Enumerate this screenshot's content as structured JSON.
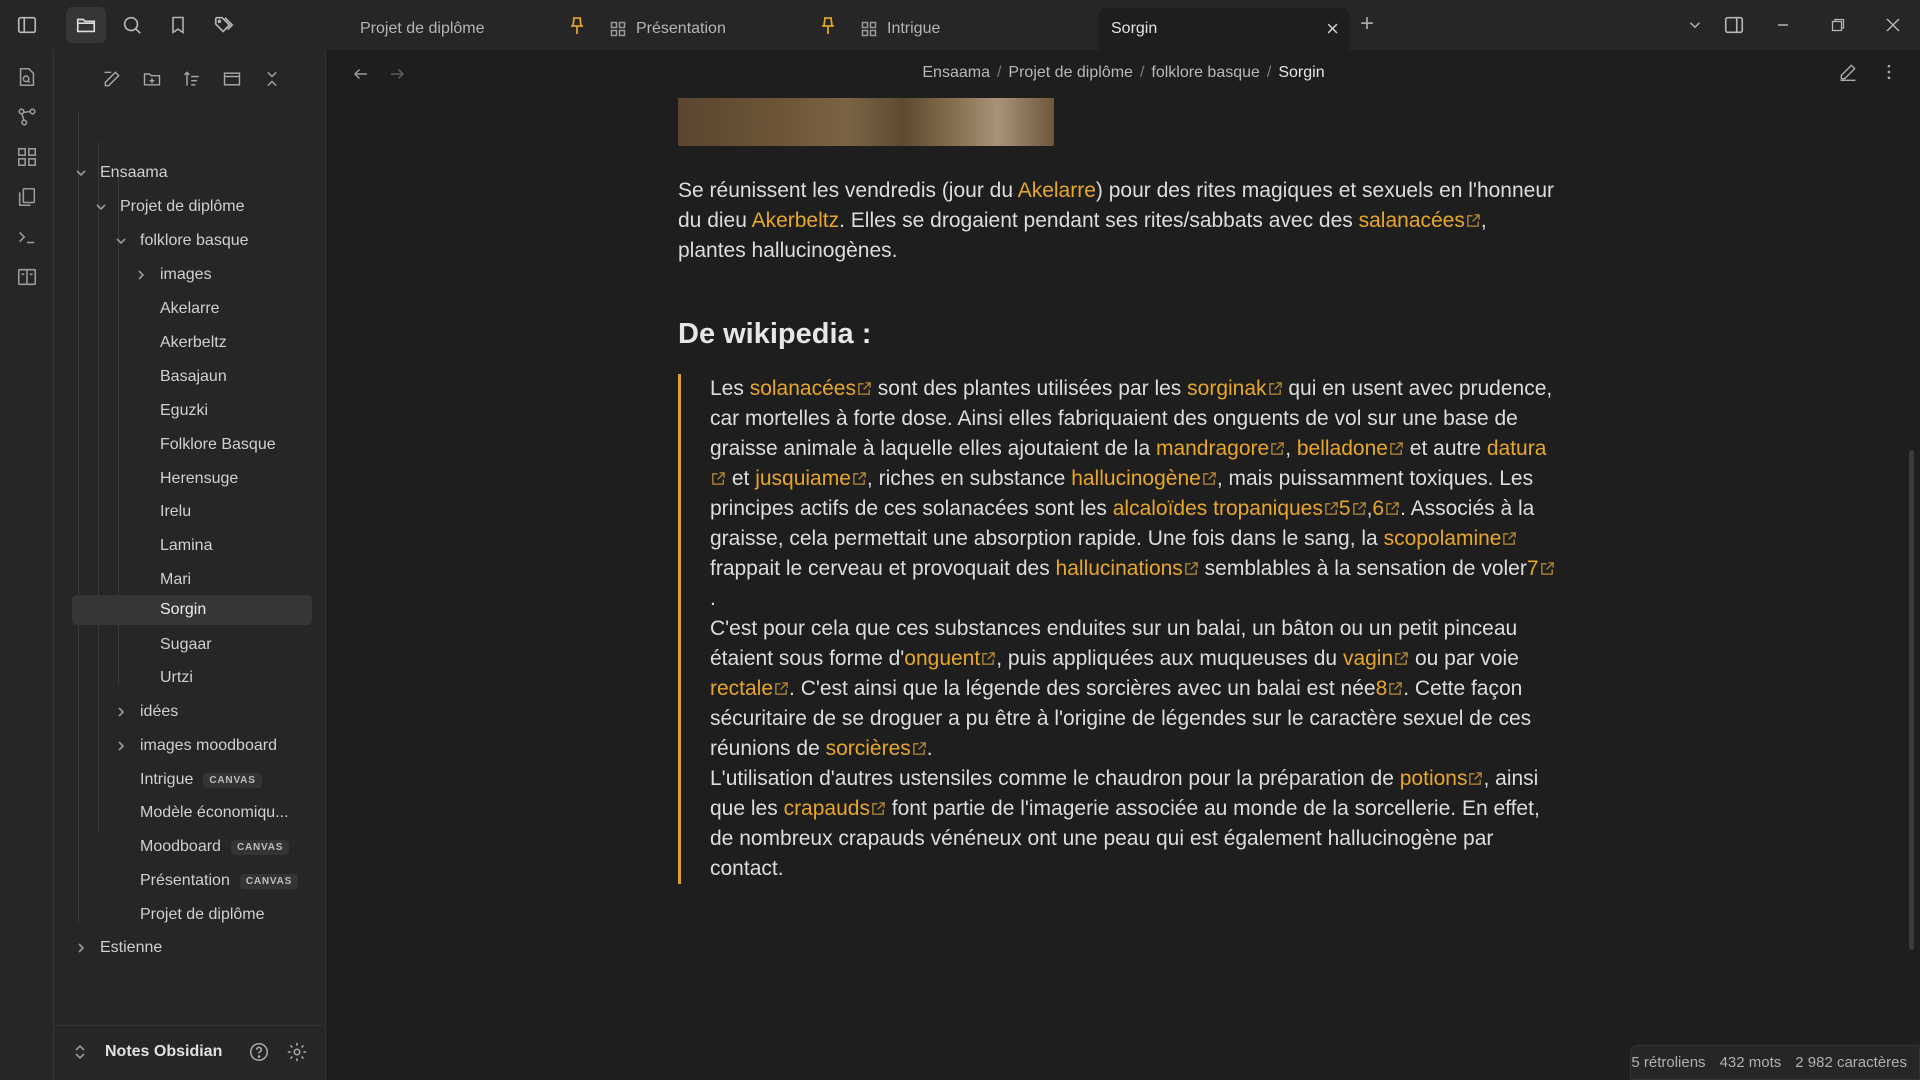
{
  "tabs": [
    {
      "label": "Projet de diplôme",
      "icon": "none",
      "pinned": true
    },
    {
      "label": "Présentation",
      "icon": "canvas-icon",
      "pinned": true
    },
    {
      "label": "Intrigue",
      "icon": "canvas-icon",
      "pinned": false
    },
    {
      "label": "Sorgin",
      "icon": "none",
      "pinned": false,
      "active": true
    }
  ],
  "tabbar": {
    "new_tab": "+",
    "close": "×"
  },
  "breadcrumb": {
    "items": [
      "Ensaama",
      "Projet de diplôme",
      "folklore basque"
    ],
    "current": "Sorgin",
    "separator": "/"
  },
  "tree": {
    "ensaama": "Ensaama",
    "projet": "Projet de diplôme",
    "folklore": "folklore basque",
    "images": "images",
    "notes": [
      "Akelarre",
      "Akerbeltz",
      "Basajaun",
      "Eguzki",
      "Folklore Basque",
      "Herensuge",
      "Irelu",
      "Lamina",
      "Mari",
      "Sorgin",
      "Sugaar",
      "Urtzi"
    ],
    "selected": "Sorgin",
    "idees": "idées",
    "moodboard_folder": "images moodboard",
    "intrigue": "Intrigue",
    "modele": "Modèle économiqu...",
    "moodboard": "Moodboard",
    "presentation": "Présentation",
    "projet_note": "Projet de diplôme",
    "canvas_badge": "CANVAS",
    "estienne": "Estienne"
  },
  "vault": {
    "name": "Notes Obsidian"
  },
  "article": {
    "p1": {
      "t1": "Se réunissent les vendredis (jour du ",
      "l1": "Akelarre",
      "t2": ") pour des rites magiques et sexuels en l'honneur du dieu ",
      "l2": "Akerbeltz",
      "t3": ". Elles se drogaient pendant ses rites/sabbats avec des ",
      "l3": "salanacées",
      "t4": ", plantes hallucinogènes."
    },
    "heading": "De wikipedia :",
    "q1": {
      "a": "Les ",
      "l_solanacees": "solanacées",
      "b": " sont des plantes utilisées par les ",
      "l_sorginak": "sorginak",
      "c": " qui en usent avec prudence, car mortelles à forte dose. Ainsi elles fabriquaient des onguents de vol sur une base de graisse animale à laquelle elles ajoutaient de la ",
      "l_mandragore": "mandragore",
      "d": ", ",
      "l_belladone": "belladone",
      "e": " et autre ",
      "l_datura": "datura",
      "f": " et ",
      "l_jusquiame": "jusquiame",
      "g": ", riches en substance ",
      "l_hallucinogene": "hallucinogène",
      "h": ", mais puissamment toxiques. Les principes actifs de ces solanacées sont les ",
      "l_alcaloides": "alcaloïdes tropaniques",
      "ref5": "5",
      "comma": ",",
      "ref6": "6",
      "i": ". Associés à la graisse, cela permettait une absorption rapide. Une fois dans le sang, la ",
      "l_scopolamine": "scopolamine",
      "j": " frappait le cerveau et provoquait des ",
      "l_hallucinations": "hallucinations",
      "k": " semblables à la sensation de voler",
      "ref7": "7",
      "end": "."
    },
    "q2": {
      "a": "C'est pour cela que ces substances enduites sur un balai, un bâton ou un petit pinceau étaient sous forme d'",
      "l_onguent": "onguent",
      "b": ", puis appliquées aux muqueuses du ",
      "l_vagin": "vagin",
      "c": " ou par voie ",
      "l_rectale": "rectale",
      "d": ". C'est ainsi que la légende des sorcières avec un balai est née",
      "ref8": "8",
      "e": ". Cette façon sécuritaire de se droguer a pu être à l'origine de légendes sur le caractère sexuel de ces réunions de ",
      "l_sorcieres": "sorcières",
      "end": "."
    },
    "q3": {
      "a": "L'utilisation d'autres ustensiles comme le chaudron pour la préparation de ",
      "l_potions": "potions",
      "b": ", ainsi que les ",
      "l_crapauds": "crapauds",
      "c": " font partie de l'imagerie associée au monde de la sorcellerie. En effet, de nombreux crapauds vénéneux ont une peau qui est également hallucinogène par contact."
    }
  },
  "status": {
    "backlinks": "5 rétroliens",
    "words": "432 mots",
    "chars": "2 982 caractères"
  },
  "colors": {
    "accent": "#e8a727",
    "background": "#1e1e1e",
    "sidebar": "#262626"
  }
}
